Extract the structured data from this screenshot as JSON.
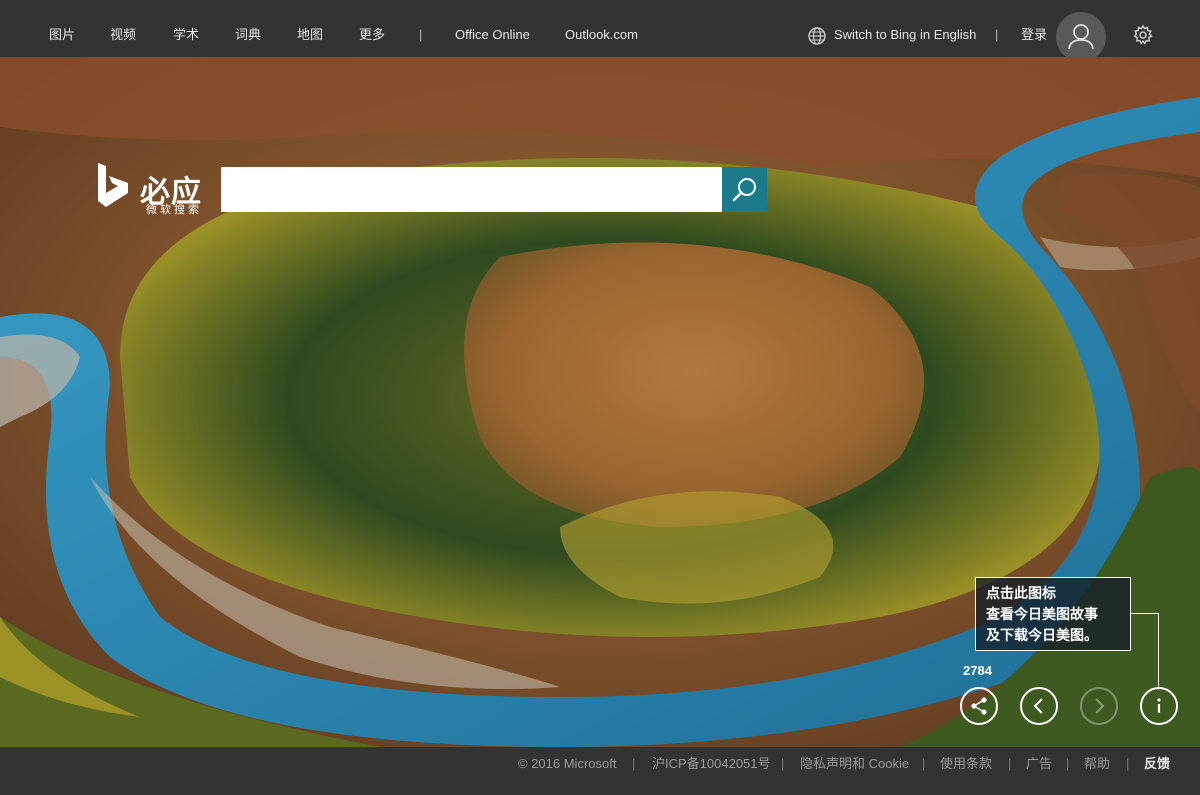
{
  "nav": {
    "items": [
      "图片",
      "视频",
      "学术",
      "词典",
      "地图",
      "更多"
    ],
    "separator": "|",
    "office": "Office Online",
    "outlook": "Outlook.com",
    "switch_lang": "Switch to Bing in English",
    "login": "登录"
  },
  "logo": {
    "name": "必应",
    "subtitle": "微软搜索"
  },
  "search": {
    "value": "",
    "placeholder": ""
  },
  "tooltip": {
    "lines": [
      "点击此图标",
      "查看今日美图故事",
      "及下载今日美图。"
    ]
  },
  "share_count": "2784",
  "controls": [
    "share-icon",
    "chevron-left-icon",
    "chevron-right-icon",
    "info-icon"
  ],
  "footer": {
    "copyright": "© 2016 Microsoft",
    "icp": "沪ICP备10042051号",
    "privacy": "隐私声明和 Cookie",
    "terms": "使用条款",
    "ads": "广告",
    "help": "帮助",
    "feedback": "反馈",
    "separator": "|"
  },
  "colors": {
    "bar": "#333333",
    "search_button": "#1b7b8a",
    "accent": "#ffffff"
  }
}
